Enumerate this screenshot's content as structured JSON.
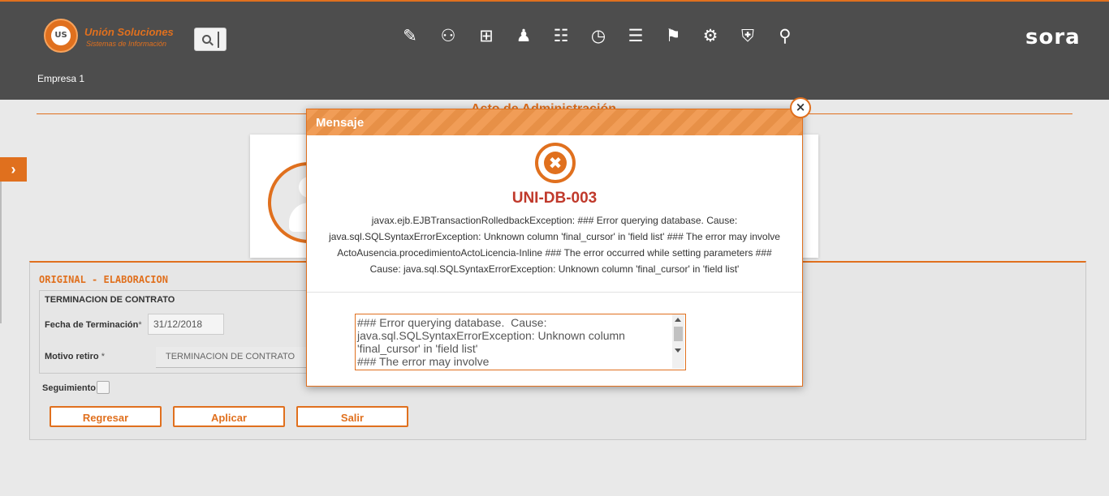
{
  "header": {
    "logo_title": "Unión Soluciones",
    "logo_subtitle": "Sistemas de Información",
    "logo_mark": "US",
    "brand": "sora",
    "company": "Empresa 1",
    "nav_icons": [
      "edit-document-icon",
      "user-admin-icon",
      "gift-icon",
      "org-chart-icon",
      "user-list-icon",
      "stopwatch-icon",
      "document-list-icon",
      "presentation-icon",
      "gears-icon",
      "briefcase-shield-icon",
      "user-search-icon"
    ]
  },
  "page": {
    "title": "Acto de Administración",
    "form_heading": "ORIGINAL - ELABORACION",
    "section_title": "TERMINACION DE CONTRATO",
    "fecha_label": "Fecha de Terminación",
    "fecha_value": "31/12/2018",
    "motivo_label": "Motivo retiro",
    "motivo_value": "TERMINACION DE CONTRATO",
    "seguimiento_label": "Seguimiento",
    "required_mark": "*",
    "buttons": {
      "regresar": "Regresar",
      "aplicar": "Aplicar",
      "salir": "Salir"
    }
  },
  "modal": {
    "title": "Mensaje",
    "close": "×",
    "error_code": "UNI-DB-003",
    "error_lines": [
      "javax.ejb.EJBTransactionRolledbackException: ### Error querying database. Cause:",
      "java.sql.SQLSyntaxErrorException: Unknown column 'final_cursor' in 'field list' ### The error may involve",
      "ActoAusencia.procedimientoActoLicencia-Inline ### The error occurred while setting parameters ###",
      "Cause: java.sql.SQLSyntaxErrorException: Unknown column 'final_cursor' in 'field list'"
    ],
    "detail_text": "### Error querying database.  Cause:\njava.sql.SQLSyntaxErrorException: Unknown column\n'final_cursor' in 'field list'\n### The error may involve"
  },
  "colors": {
    "accent": "#e0701e",
    "header_bg": "#4d4d4d",
    "error": "#c0392b"
  }
}
